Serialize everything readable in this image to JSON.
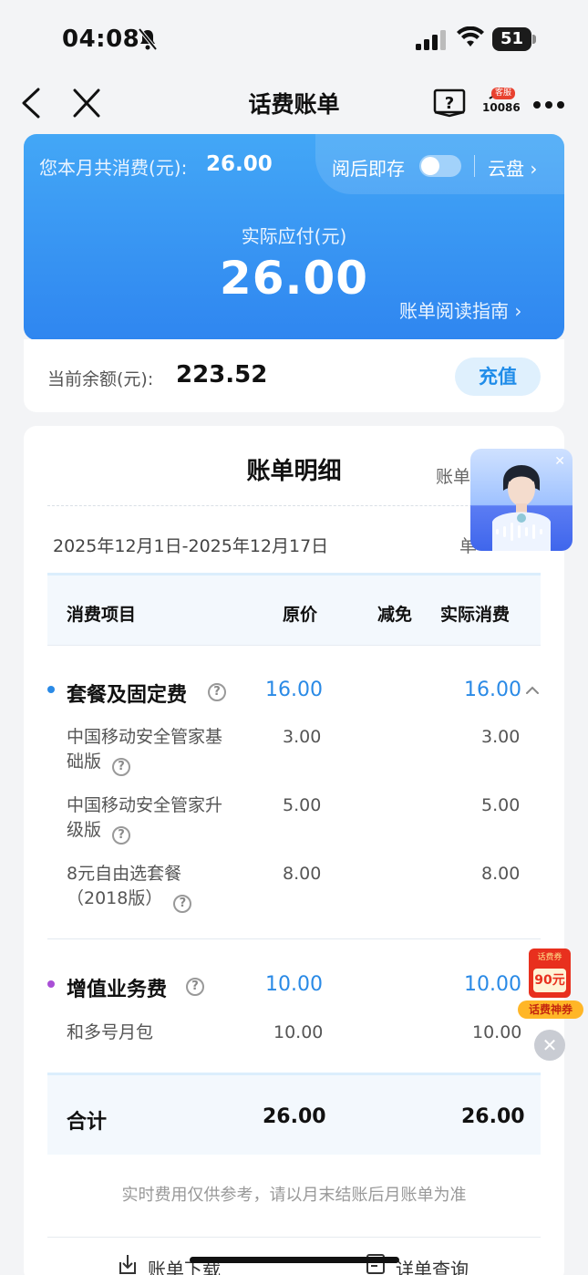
{
  "status_bar": {
    "time": "04:08",
    "battery": "51"
  },
  "nav": {
    "title": "话费账单",
    "service_badge": "客服",
    "service_number": "10086"
  },
  "summary": {
    "month_label": "您本月共消费(元):",
    "month_value": "26.00",
    "save_label": "阅后即存",
    "cloud_link": "云盘",
    "pay_label": "实际应付(元)",
    "pay_value": "26.00",
    "guide_link": "账单阅读指南"
  },
  "balance": {
    "label": "当前余额(元):",
    "value": "223.52",
    "topup_label": "充值"
  },
  "detail": {
    "title": "账单明细",
    "side_label": "账单",
    "period": "2025年12月1日-2025年12月17日",
    "period_side": "单",
    "columns": [
      "消费项目",
      "原价",
      "减免",
      "实际消费"
    ],
    "sections": [
      {
        "name": "套餐及固定费",
        "original": "16.00",
        "actual": "16.00",
        "items": [
          {
            "name_line1": "中国移动安全管家基",
            "name_line2": "础版",
            "original": "3.00",
            "actual": "3.00"
          },
          {
            "name_line1": "中国移动安全管家升",
            "name_line2": "级版",
            "original": "5.00",
            "actual": "5.00"
          },
          {
            "name_line1": "8元自由选套餐",
            "name_line2": "（2018版）",
            "original": "8.00",
            "actual": "8.00"
          }
        ]
      },
      {
        "name": "增值业务费",
        "original": "10.00",
        "actual": "10.00",
        "items": [
          {
            "name_line1": "和多号月包",
            "original": "10.00",
            "actual": "10.00"
          }
        ]
      }
    ],
    "total": {
      "label": "合计",
      "original": "26.00",
      "actual": "26.00"
    },
    "note": "实时费用仅供参考，请以月末结账后月账单为准",
    "download_label": "账单下载",
    "query_label": "详单查询"
  },
  "coupon": {
    "top": "话费券",
    "amount": "90元",
    "bottom": "话费神券"
  },
  "colors": {
    "accent": "#2a8ae6",
    "dot_blue": "#2a8ae6",
    "dot_purple": "#a94fd6"
  }
}
